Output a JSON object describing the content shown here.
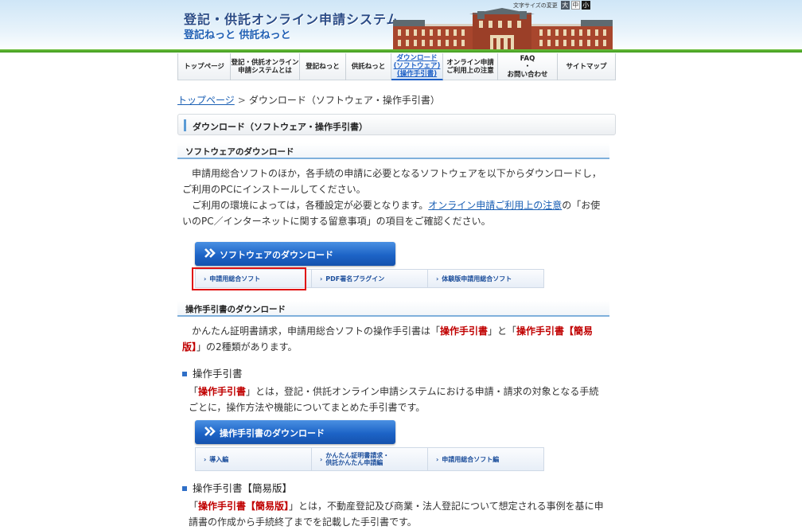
{
  "header": {
    "title": "登記・供託オンライン申請システム",
    "subtitle": "登記ねっと 供託ねっと",
    "font_size_label": "文字サイズの変更",
    "font_size_buttons": [
      "大",
      "中",
      "小"
    ]
  },
  "nav": {
    "items": [
      {
        "label": "トップページ"
      },
      {
        "label": "登記・供託オンライン\n申請システムとは"
      },
      {
        "label": "登記ねっと"
      },
      {
        "label": "供託ねっと"
      },
      {
        "label": "ダウンロード\n(ソフトウェア)\n(操作手引書)"
      },
      {
        "label": "オンライン申請\nご利用上の注意"
      },
      {
        "label": "FAQ\n・\nお問い合わせ"
      },
      {
        "label": "サイトマップ"
      }
    ],
    "active_index": 4
  },
  "breadcrumb": {
    "home": "トップページ",
    "separator": ">",
    "current": "ダウンロード（ソフトウェア・操作手引書）"
  },
  "page_title": "ダウンロード（ソフトウェア・操作手引書）",
  "software": {
    "heading": "ソフトウェアのダウンロード",
    "para1": "申請用総合ソフトのほか，各手続の申請に必要となるソフトウェアを以下からダウンロードし，ご利用のPCにインストールしてください。",
    "para2_before": "ご利用の環境によっては，各種設定が必要となります。",
    "para2_link": "オンライン申請ご利用上の注意",
    "para2_after": "の「お使いのPC／インターネットに関する留意事項」の項目をご確認ください。",
    "banner": "ソフトウェアのダウンロード",
    "links": [
      "申請用総合ソフト",
      "PDF署名プラグイン",
      "体験版申請用総合ソフト"
    ]
  },
  "manual": {
    "heading": "操作手引書のダウンロード",
    "intro_before": "かんたん証明書請求，申請用総合ソフトの操作手引書は「",
    "intro_red1": "操作手引書",
    "intro_mid": "」と「",
    "intro_red2": "操作手引書【簡易版】",
    "intro_after": "」の2種類があります。",
    "sub1_title": "操作手引書",
    "sub1_open": "「",
    "sub1_red": "操作手引書",
    "sub1_text": "」とは，登記・供託オンライン申請システムにおける申請・請求の対象となる手続ごとに，操作方法や機能についてまとめた手引書です。",
    "banner": "操作手引書のダウンロード",
    "links": [
      "導入編",
      "かんたん証明書請求・\n供託かんたん申請編",
      "申請用総合ソフト編"
    ],
    "sub2_title": "操作手引書【簡易版】",
    "sub2_open": "「",
    "sub2_red": "操作手引書【簡易版】",
    "sub2_text": "」とは，不動産登記及び商業・法人登記について想定される事例を基に申請書の作成から手続終了までを記載した手引書です。"
  },
  "colors": {
    "nav_active": "#1e60c6",
    "link": "#1a5fb4",
    "emphasis_red": "#c00000",
    "banner_blue": "#1d64c7",
    "header_green": "#4aa625",
    "highlight_box": "#e01010"
  }
}
